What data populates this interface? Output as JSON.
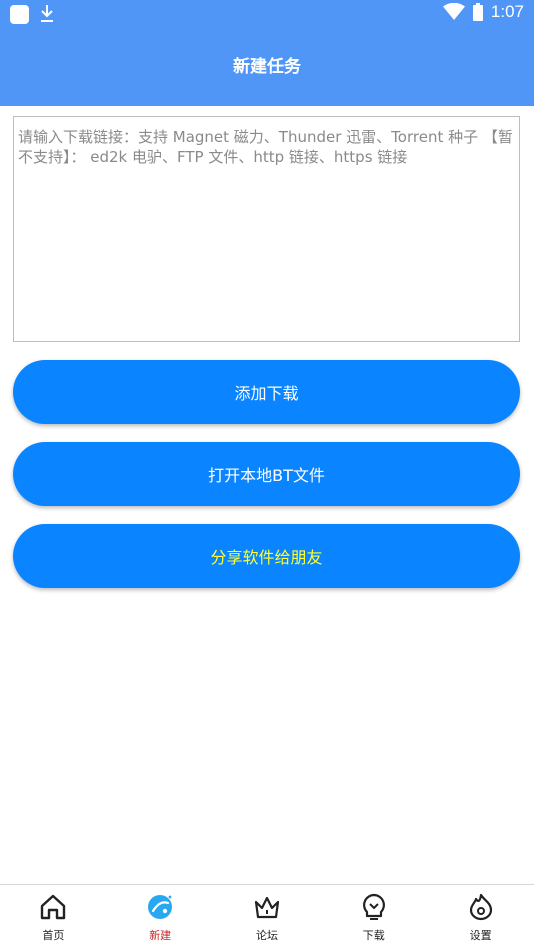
{
  "status_bar": {
    "time": "1:07",
    "icons": [
      "app-notification-icon",
      "download-icon",
      "wifi-icon",
      "battery-icon"
    ]
  },
  "app_bar": {
    "title": "新建任务"
  },
  "link_input": {
    "value": "",
    "placeholder": "请输入下载链接：支持 Magnet 磁力、Thunder 迅雷、Torrent 种子 【暂不支持】： ed2k 电驴、FTP 文件、http 链接、https 链接"
  },
  "buttons": {
    "add_download": "添加下载",
    "open_local_bt": "打开本地BT文件",
    "share_app": "分享软件给朋友"
  },
  "tabs": [
    {
      "label": "首页",
      "icon": "home-icon"
    },
    {
      "label": "新建",
      "icon": "planet-icon",
      "active": true
    },
    {
      "label": "论坛",
      "icon": "crown-icon"
    },
    {
      "label": "下载",
      "icon": "lightbulb-icon"
    },
    {
      "label": "设置",
      "icon": "flame-icon"
    }
  ],
  "colors": {
    "primary": "#4f96f7",
    "button": "#0a84ff",
    "share_text": "#ffff33",
    "active_tab": "#c62828",
    "active_icon": "#29a8f2"
  }
}
